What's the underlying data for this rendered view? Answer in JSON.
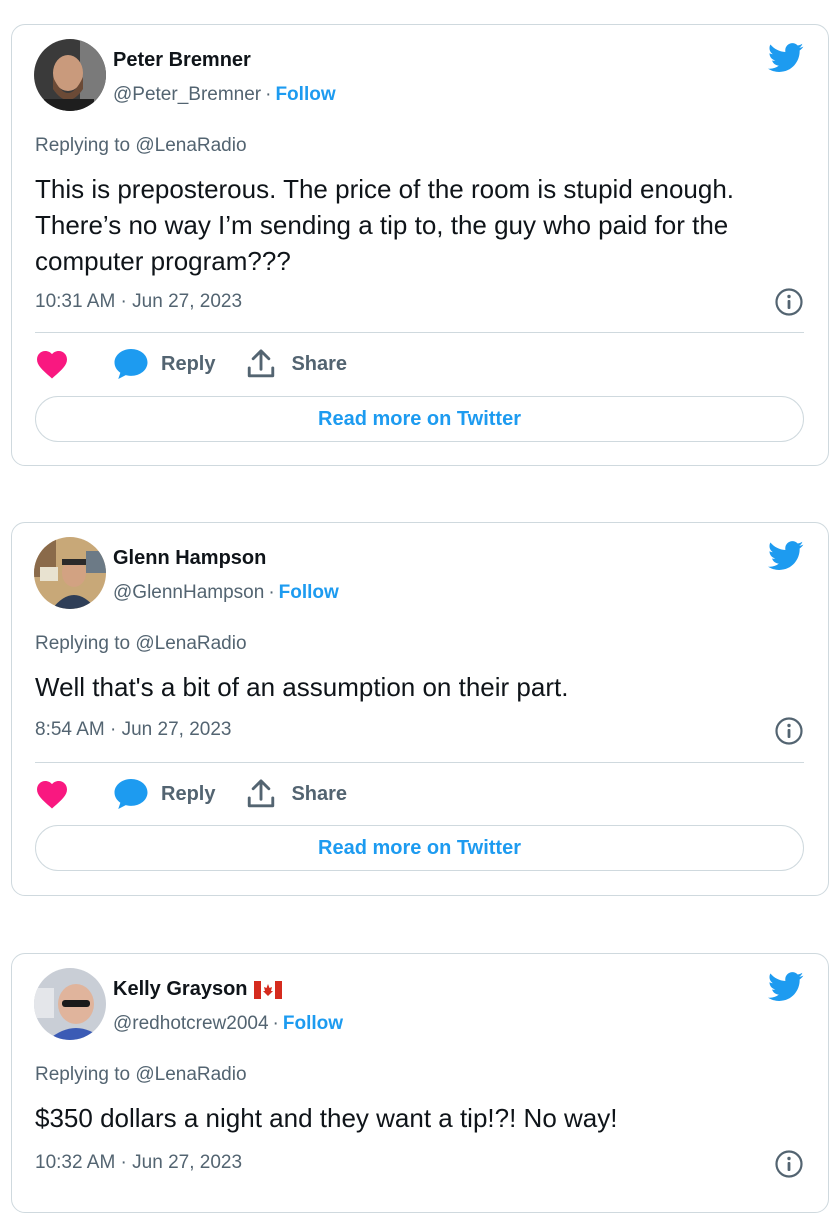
{
  "colors": {
    "accent": "#1d9bf0",
    "like": "#f91880",
    "text": "#0f1419",
    "secondary": "#536471",
    "border": "#cfd9de"
  },
  "tweets": [
    {
      "author": "Peter Bremner",
      "handle": "@Peter_Bremner",
      "dot": "·",
      "follow": "Follow",
      "replying_to": "Replying to @LenaRadio",
      "text": "This is preposterous. The price of the room is stupid enough. There’s no way I’m sending a tip to, the guy who paid for the computer program???",
      "timestamp": "10:31 AM · Jun 27, 2023",
      "reply_label": "Reply",
      "share_label": "Share",
      "read_more": "Read more on Twitter",
      "avatar_icon": "avatar-photo",
      "info_icon": "info-icon"
    },
    {
      "author": "Glenn Hampson",
      "handle": "@GlennHampson",
      "dot": "·",
      "follow": "Follow",
      "replying_to": "Replying to @LenaRadio",
      "text": "Well that's a bit of an assumption on their part.",
      "timestamp": "8:54 AM · Jun 27, 2023",
      "reply_label": "Reply",
      "share_label": "Share",
      "read_more": "Read more on Twitter",
      "avatar_icon": "avatar-photo",
      "info_icon": "info-icon"
    },
    {
      "author": "Kelly Grayson",
      "author_flag": "canada-flag-icon",
      "handle": "@redhotcrew2004",
      "dot": "·",
      "follow": "Follow",
      "replying_to": "Replying to @LenaRadio",
      "text": "$350 dollars a night and they want a tip!?! No way!",
      "timestamp": "10:32 AM · Jun 27, 2023",
      "avatar_icon": "avatar-photo",
      "info_icon": "info-icon"
    }
  ]
}
